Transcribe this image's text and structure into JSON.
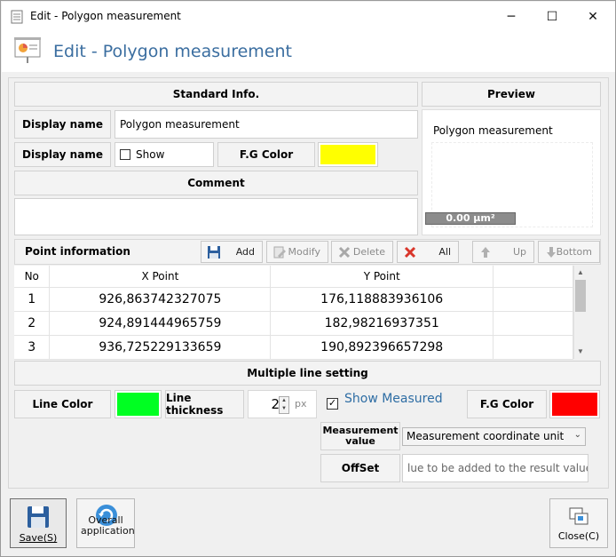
{
  "window": {
    "title": "Edit - Polygon measurement",
    "minimize": "─",
    "maximize": "☐",
    "close": "✕"
  },
  "header": {
    "title": "Edit - Polygon measurement"
  },
  "standard": {
    "section_title": "Standard Info.",
    "display_name_label": "Display name",
    "display_name_value": "Polygon measurement",
    "display_label2": "Display name",
    "show_label": "Show",
    "fg_color_label": "F.G Color",
    "fg_color": "#ffff00",
    "comment_label": "Comment",
    "comment_value": ""
  },
  "preview": {
    "section_title": "Preview",
    "name": "Polygon measurement",
    "value_badge": "0.00 µm²"
  },
  "points": {
    "section_title": "Point information",
    "buttons": {
      "add": "Add",
      "modify": "Modify",
      "delete": "Delete",
      "all": "All",
      "up": "Up",
      "bottom": "Bottom"
    },
    "columns": [
      "No",
      "X Point",
      "Y Point"
    ],
    "rows": [
      {
        "no": "1",
        "x": "926,863742327075",
        "y": "176,118883936106"
      },
      {
        "no": "2",
        "x": "924,891444965759",
        "y": "182,98216937351"
      },
      {
        "no": "3",
        "x": "936,725229133659",
        "y": "190,892396657298"
      }
    ]
  },
  "line_setting": {
    "section_title": "Multiple line setting",
    "line_color_label": "Line Color",
    "line_color": "#00ff22",
    "thickness_label": "Line thickness",
    "thickness_value": "2",
    "thickness_unit": "px",
    "show_measured_label": "Show Measured",
    "fg_color_label": "F.G Color",
    "fg_color": "#ff0000",
    "measurement_value_label": "Measurement value",
    "measurement_value_selected": "Measurement coordinate unit",
    "offset_label": "OffSet",
    "offset_placeholder": "lue to be added to the result value)"
  },
  "footer": {
    "save_label": "Save(S)",
    "overall_label": "Overall application",
    "close_label": "Close(C)"
  }
}
